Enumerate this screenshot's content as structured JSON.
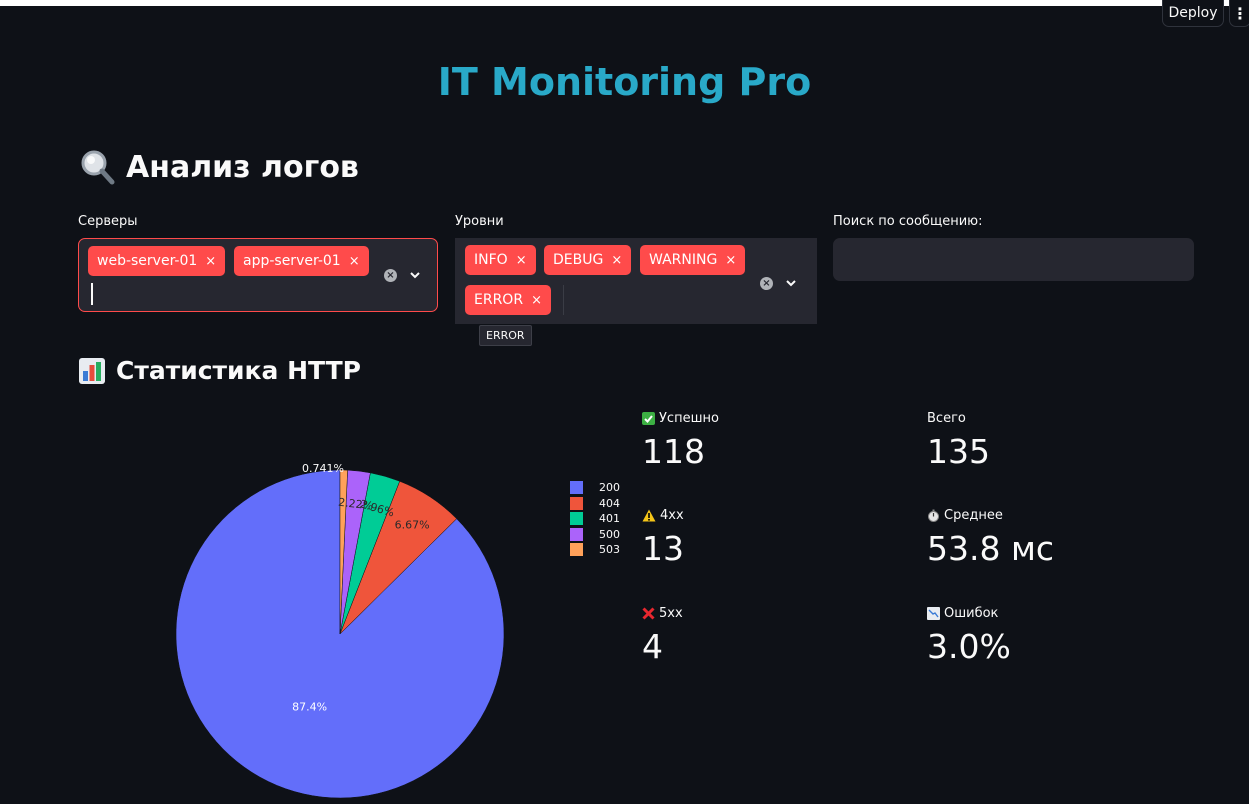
{
  "header": {
    "deploy_label": "Deploy",
    "menu_label": "⋮"
  },
  "app_title": "IT Monitoring Pro",
  "logs_section": {
    "title": "Анализ логов",
    "servers": {
      "label": "Серверы",
      "selected": [
        "web-server-01",
        "app-server-01"
      ]
    },
    "levels": {
      "label": "Уровни",
      "selected": [
        "INFO",
        "DEBUG",
        "WARNING",
        "ERROR"
      ],
      "tooltip": "ERROR"
    },
    "search": {
      "label": "Поиск по сообщению:",
      "value": "",
      "placeholder": ""
    },
    "tag_remove_glyph": "×",
    "clear_glyph": "×"
  },
  "http_section": {
    "title": "Статистика HTTP"
  },
  "chart_data": {
    "type": "pie",
    "title": "",
    "categories": [
      "200",
      "404",
      "401",
      "500",
      "503"
    ],
    "values": [
      118,
      9,
      4,
      3,
      1
    ],
    "labels": [
      "87.4%",
      "6.67%",
      "2.96%",
      "2.22%",
      "0.741%"
    ],
    "colors": [
      "#636efa",
      "#ef553b",
      "#00cc96",
      "#ab63fa",
      "#ffa15a"
    ],
    "legend": "right"
  },
  "metrics": {
    "success": {
      "label": "Успешно",
      "value": "118",
      "icon": "check-box-icon"
    },
    "total": {
      "label": "Всего",
      "value": "135"
    },
    "client_errors": {
      "label": "4xx",
      "value": "13",
      "icon": "warning-icon"
    },
    "average": {
      "label": "Среднее",
      "value": "53.8 мс",
      "icon": "stopwatch-icon"
    },
    "server_errors": {
      "label": "5xx",
      "value": "4",
      "icon": "cross-icon"
    },
    "error_rate": {
      "label": "Ошибок",
      "value": "3.0%",
      "icon": "chart-down-icon"
    }
  }
}
